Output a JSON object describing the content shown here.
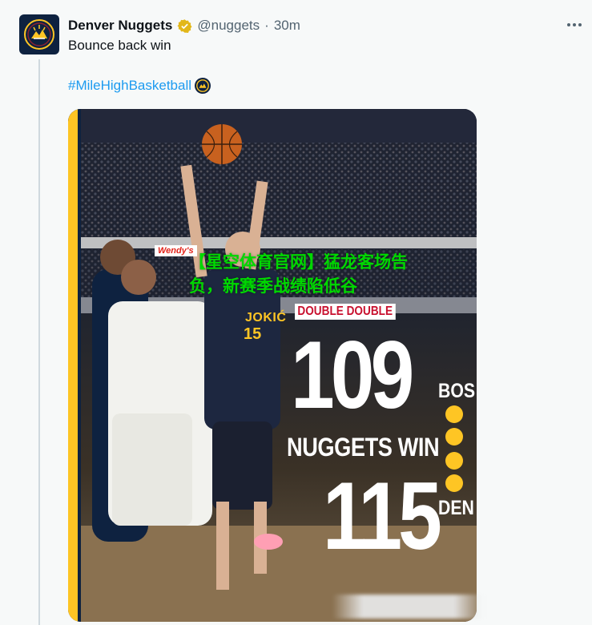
{
  "account": {
    "display_name": "Denver Nuggets",
    "handle": "@nuggets",
    "separator": "·",
    "time": "30m"
  },
  "tweet": {
    "text": "Bounce back win",
    "hashtag": "#MileHighBasketball"
  },
  "graphic": {
    "score_top": "109",
    "score_bottom": "115",
    "headline": "NUGGETS WIN",
    "team_top": "BOS",
    "team_bottom": "DEN",
    "banner": "DOUBLE DOUBLE",
    "sponsor": "Wendy's",
    "jersey_name": "JOKIĆ",
    "jersey_number": "15",
    "accent_color": "#fec524",
    "navy_color": "#0e2240"
  },
  "watermark": {
    "text": "【星空体育官网】猛龙客场告负，新赛季战绩陷低谷"
  },
  "icons": {
    "verified": "verified-badge-icon",
    "more": "more-options-icon",
    "avatar": "nuggets-logo-icon",
    "hashflag": "nuggets-hashflag-icon"
  }
}
